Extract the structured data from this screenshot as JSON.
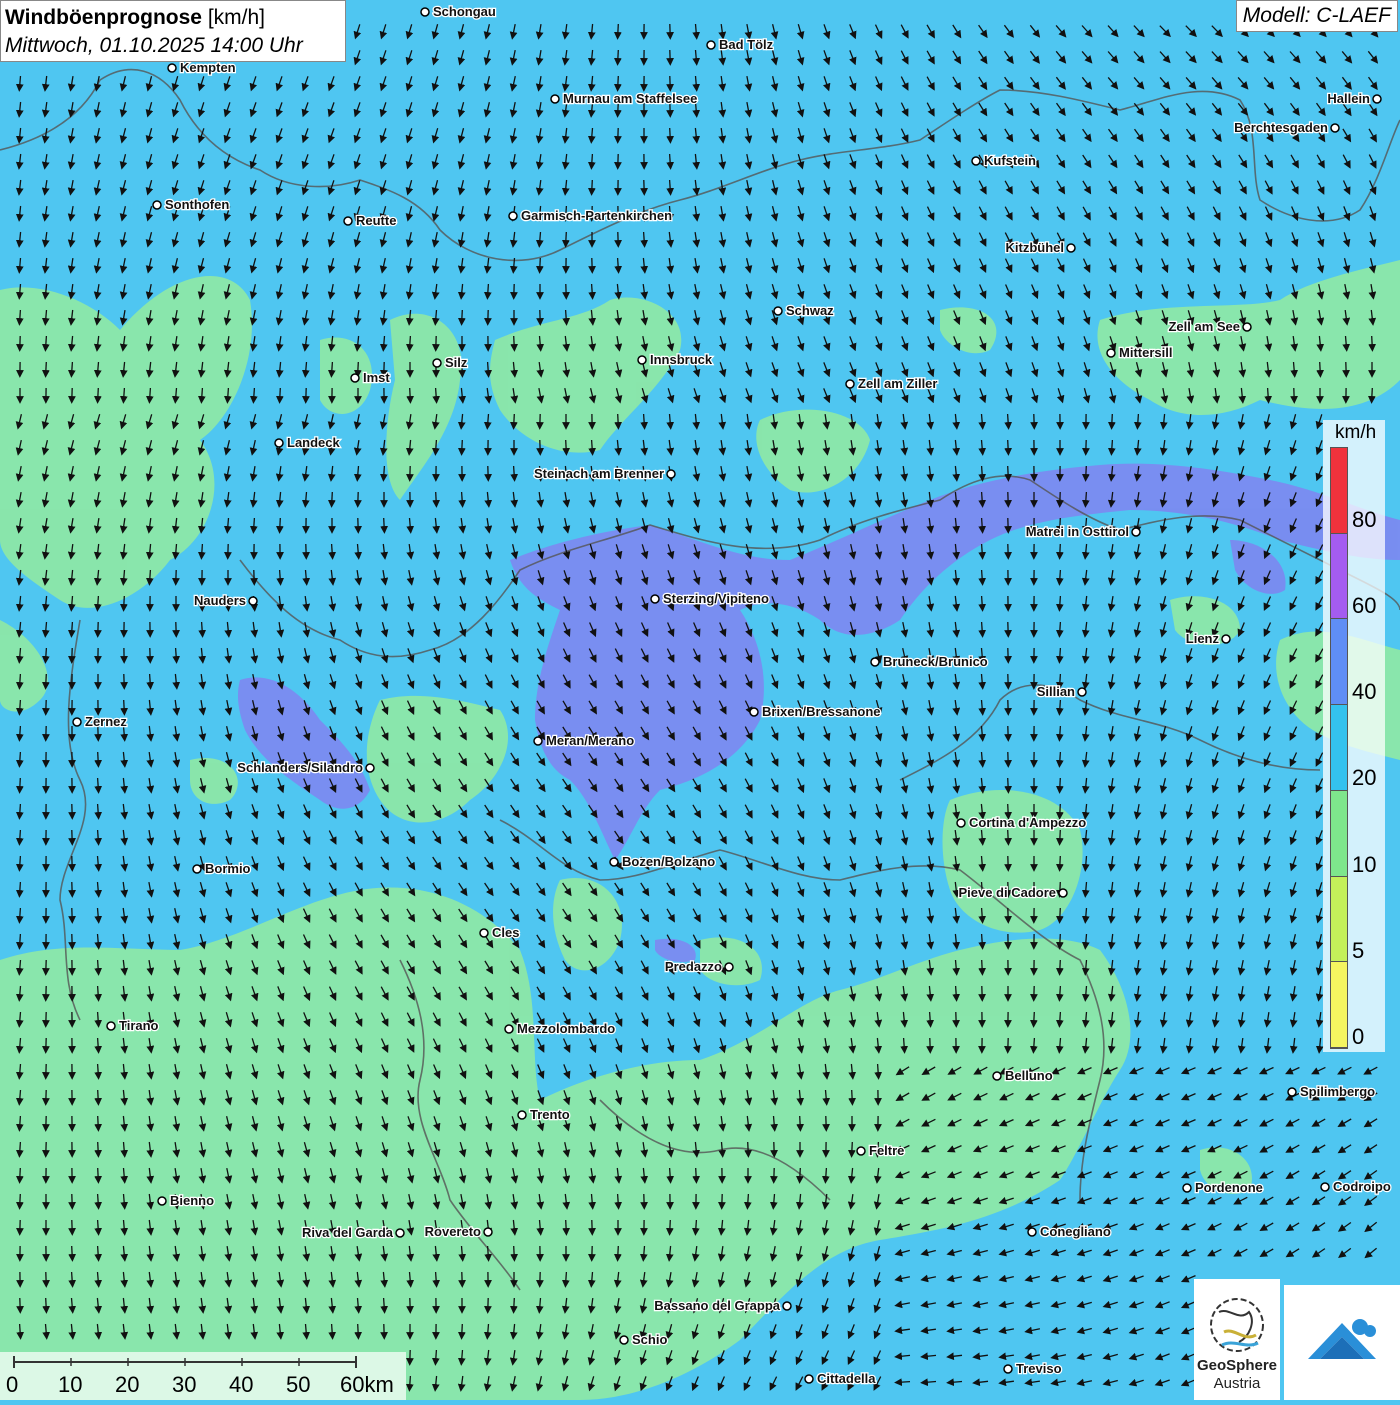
{
  "header": {
    "title_bold": "Windböenprognose",
    "title_unit": "[km/h]",
    "subtitle": "Mittwoch, 01.10.2025 14:00 Uhr",
    "model": "Modell: C-LAEF"
  },
  "legend": {
    "unit": "km/h",
    "ticks": [
      "80",
      "60",
      "40",
      "20",
      "10",
      "5",
      "0"
    ],
    "colors": [
      "#f0323c",
      "#a45cf0",
      "#5f8ef5",
      "#34c2ee",
      "#7ee68c",
      "#c4f05a",
      "#f5f560"
    ]
  },
  "colors": {
    "base_wind": "#4fc6f1",
    "green_zone": "#8ee8a6",
    "purple_zone": "#7b8bf0",
    "arrow": "#111111",
    "border": "#555555"
  },
  "cities": [
    "Schongau",
    "Bad Tölz",
    "Kempten",
    "Murnau am Staffelsee",
    "Hallein",
    "Berchtesgaden",
    "Kufstein",
    "Sonthofen",
    "Reutte",
    "Garmisch-Partenkirchen",
    "Kitzbühel",
    "Schwaz",
    "Zell am See",
    "Mittersill",
    "Innsbruck",
    "Imst",
    "Silz",
    "Zell am Ziller",
    "Landeck",
    "Steinach am Brenner",
    "Matrei in Osttirol",
    "Nauders",
    "Sterzing/Vipiteno",
    "Lienz",
    "Bruneck/Brunico",
    "Sillian",
    "Brixen/Bressanone",
    "Zernez",
    "Meran/Merano",
    "Schlanders/Silandro",
    "Cortina d'Ampezzo",
    "Bormio",
    "Bozen/Bolzano",
    "Pieve di Cadore",
    "Cles",
    "Predazzo",
    "Tirano",
    "Mezzolombardo",
    "Belluno",
    "Spilimbergo",
    "Trento",
    "Feltre",
    "Pordenone",
    "Codroipo",
    "Bienno",
    "Riva del Garda",
    "Rovereto",
    "Conegliano",
    "Bassano del Grappa",
    "Schio",
    "Treviso",
    "Cittadella"
  ],
  "scale": {
    "labels": [
      "0",
      "10",
      "20",
      "30",
      "40",
      "50",
      "60km"
    ]
  },
  "logos": {
    "geosphere_line1": "GeoSphere",
    "geosphere_line2": "Austria"
  }
}
